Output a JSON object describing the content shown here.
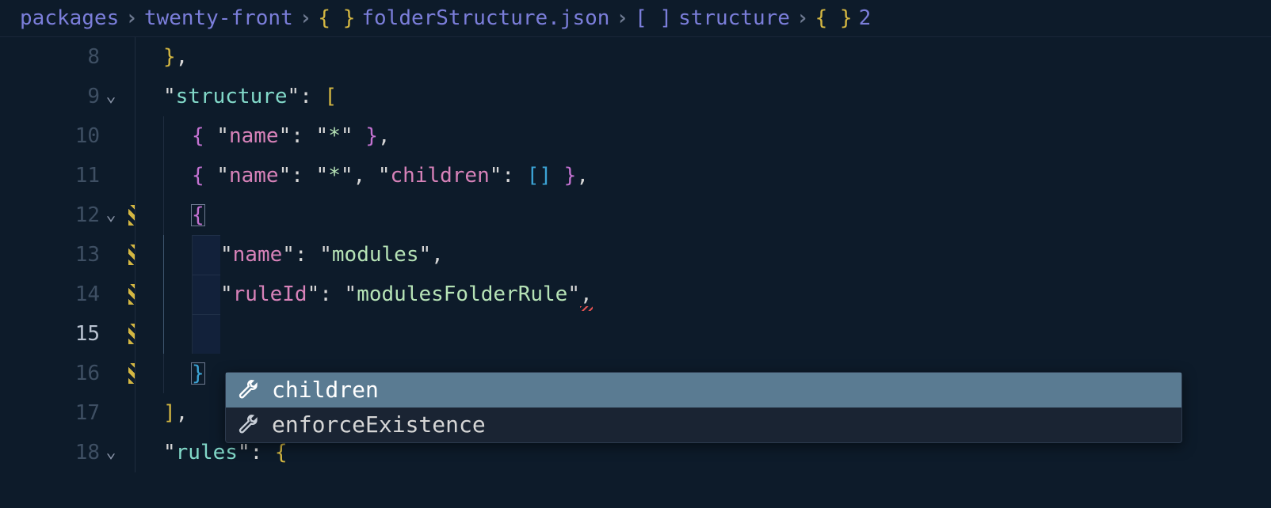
{
  "breadcrumb": {
    "seg1": "packages",
    "seg2": "twenty-front",
    "braces": "{ }",
    "seg3": "folderStructure.json",
    "brackets": "[ ]",
    "seg4": "structure",
    "braces2": "{ }",
    "seg5": "2"
  },
  "lines": {
    "8": {
      "num": "8"
    },
    "9": {
      "num": "9",
      "key": "structure"
    },
    "10": {
      "num": "10",
      "key": "name",
      "val": "*"
    },
    "11": {
      "num": "11",
      "key": "name",
      "val": "*",
      "key2": "children"
    },
    "12": {
      "num": "12"
    },
    "13": {
      "num": "13",
      "key": "name",
      "val": "modules"
    },
    "14": {
      "num": "14",
      "key": "ruleId",
      "val": "modulesFolderRule"
    },
    "15": {
      "num": "15"
    },
    "16": {
      "num": "16"
    },
    "17": {
      "num": "17"
    },
    "18": {
      "num": "18",
      "key": "rules"
    }
  },
  "suggest": {
    "item1": "children",
    "item2": "enforceExistence"
  }
}
